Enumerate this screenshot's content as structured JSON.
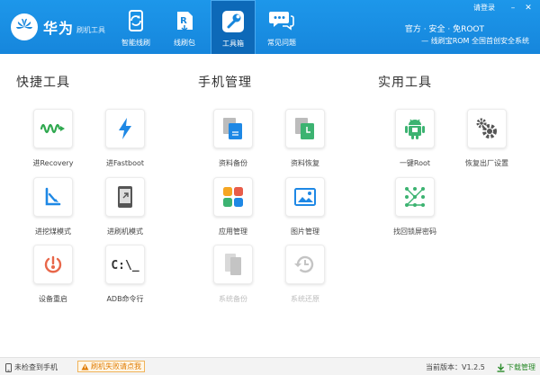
{
  "header": {
    "logo_brand": "华为",
    "logo_sub": "刷机工具",
    "login": "请登录",
    "minimize": "–",
    "close": "✕",
    "slogan_line1": "官方 · 安全 · 免ROOT",
    "slogan_line2": "— 线刷宝ROM 全国首创安全系统",
    "nav": [
      {
        "label": "智能线刷",
        "icon": "smart-flash-icon"
      },
      {
        "label": "线刷包",
        "icon": "rom-package-icon"
      },
      {
        "label": "工具箱",
        "icon": "toolbox-icon",
        "active": true
      },
      {
        "label": "常见问题",
        "icon": "faq-chat-icon"
      }
    ]
  },
  "sections": [
    {
      "title": "快捷工具",
      "tools": [
        {
          "label": "进Recovery",
          "icon": "recovery-wave-icon"
        },
        {
          "label": "进Fastboot",
          "icon": "fastboot-bolt-icon"
        },
        {
          "label": "进挖煤模式",
          "icon": "mining-mode-icon"
        },
        {
          "label": "进刷机模式",
          "icon": "flash-mode-icon"
        },
        {
          "label": "设备重启",
          "icon": "reboot-icon"
        },
        {
          "label": "ADB命令行",
          "icon": "command-line-icon"
        }
      ]
    },
    {
      "title": "手机管理",
      "tools": [
        {
          "label": "资料备份",
          "icon": "data-backup-icon"
        },
        {
          "label": "资料恢复",
          "icon": "data-restore-icon"
        },
        {
          "label": "应用管理",
          "icon": "app-manager-icon"
        },
        {
          "label": "图片管理",
          "icon": "picture-manager-icon"
        },
        {
          "label": "系统备份",
          "icon": "system-backup-icon",
          "disabled": true
        },
        {
          "label": "系统还原",
          "icon": "system-restore-icon",
          "disabled": true
        }
      ]
    },
    {
      "title": "实用工具",
      "tools": [
        {
          "label": "一键Root",
          "icon": "android-root-icon"
        },
        {
          "label": "恢复出厂设置",
          "icon": "factory-reset-gears-icon"
        },
        {
          "label": "找回锁屏密码",
          "icon": "pattern-lock-icon"
        }
      ]
    }
  ],
  "footer": {
    "status": "未检查到手机",
    "help": "刷机失败请点我",
    "version": "当前版本：V1.2.5",
    "download": "下载管理"
  },
  "colors": {
    "header": "#1686dc",
    "accent_blue": "#1e88e5",
    "green": "#3cb371",
    "orange": "#e07b00"
  }
}
